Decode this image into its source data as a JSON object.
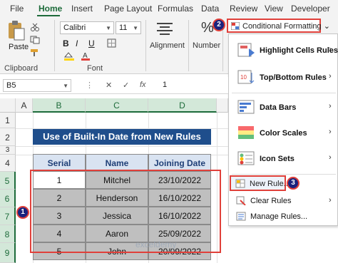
{
  "ribbon_tabs": [
    "File",
    "Home",
    "Insert",
    "Page Layout",
    "Formulas",
    "Data",
    "Review",
    "View",
    "Developer"
  ],
  "clipboard": {
    "paste_label": "Paste",
    "group_label": "Clipboard"
  },
  "font": {
    "name": "Calibri",
    "size": "11",
    "bold": "B",
    "italic": "I",
    "underline": "U",
    "group_label": "Font"
  },
  "alignment": {
    "label": "Alignment"
  },
  "number": {
    "label": "Number",
    "symbol": "%"
  },
  "conditional_formatting": {
    "button_label": "Conditional Formatting",
    "caret": "⌄"
  },
  "menu": {
    "items": [
      {
        "label": "Highlight Cells Rules",
        "arrow": "›"
      },
      {
        "label": "Top/Bottom Rules",
        "arrow": "›"
      },
      {
        "label": "Data Bars",
        "arrow": "›"
      },
      {
        "label": "Color Scales",
        "arrow": "›"
      },
      {
        "label": "Icon Sets",
        "arrow": "›"
      }
    ],
    "new_rule": "New Rule...",
    "clear_rules": "Clear Rules",
    "clear_rules_arrow": "›",
    "manage_rules": "Manage Rules..."
  },
  "formula_bar": {
    "cell_ref": "B5",
    "cancel": "✕",
    "enter": "✓",
    "fx": "fx",
    "value": "1"
  },
  "columns": [
    "A",
    "B",
    "C",
    "D"
  ],
  "rows": [
    "1",
    "2",
    "3",
    "4",
    "5",
    "6",
    "7",
    "8",
    "9"
  ],
  "sheet": {
    "title": "Use of Built-In Date from New Rules",
    "headers": [
      "Serial",
      "Name",
      "Joining Date"
    ],
    "data": [
      [
        "1",
        "Mitchel",
        "23/10/2022"
      ],
      [
        "2",
        "Henderson",
        "16/10/2022"
      ],
      [
        "3",
        "Jessica",
        "16/10/2022"
      ],
      [
        "4",
        "Aaron",
        "25/09/2022"
      ],
      [
        "5",
        "John",
        "20/09/2022"
      ]
    ]
  },
  "badges": {
    "b1": "1",
    "b2": "2",
    "b3": "3"
  },
  "watermark": "exceldemy",
  "colors": {
    "accent_green": "#1d6b3a",
    "highlight_red": "#e0403a",
    "title_blue": "#1f4e8c",
    "badge_navy": "#1a237e"
  }
}
